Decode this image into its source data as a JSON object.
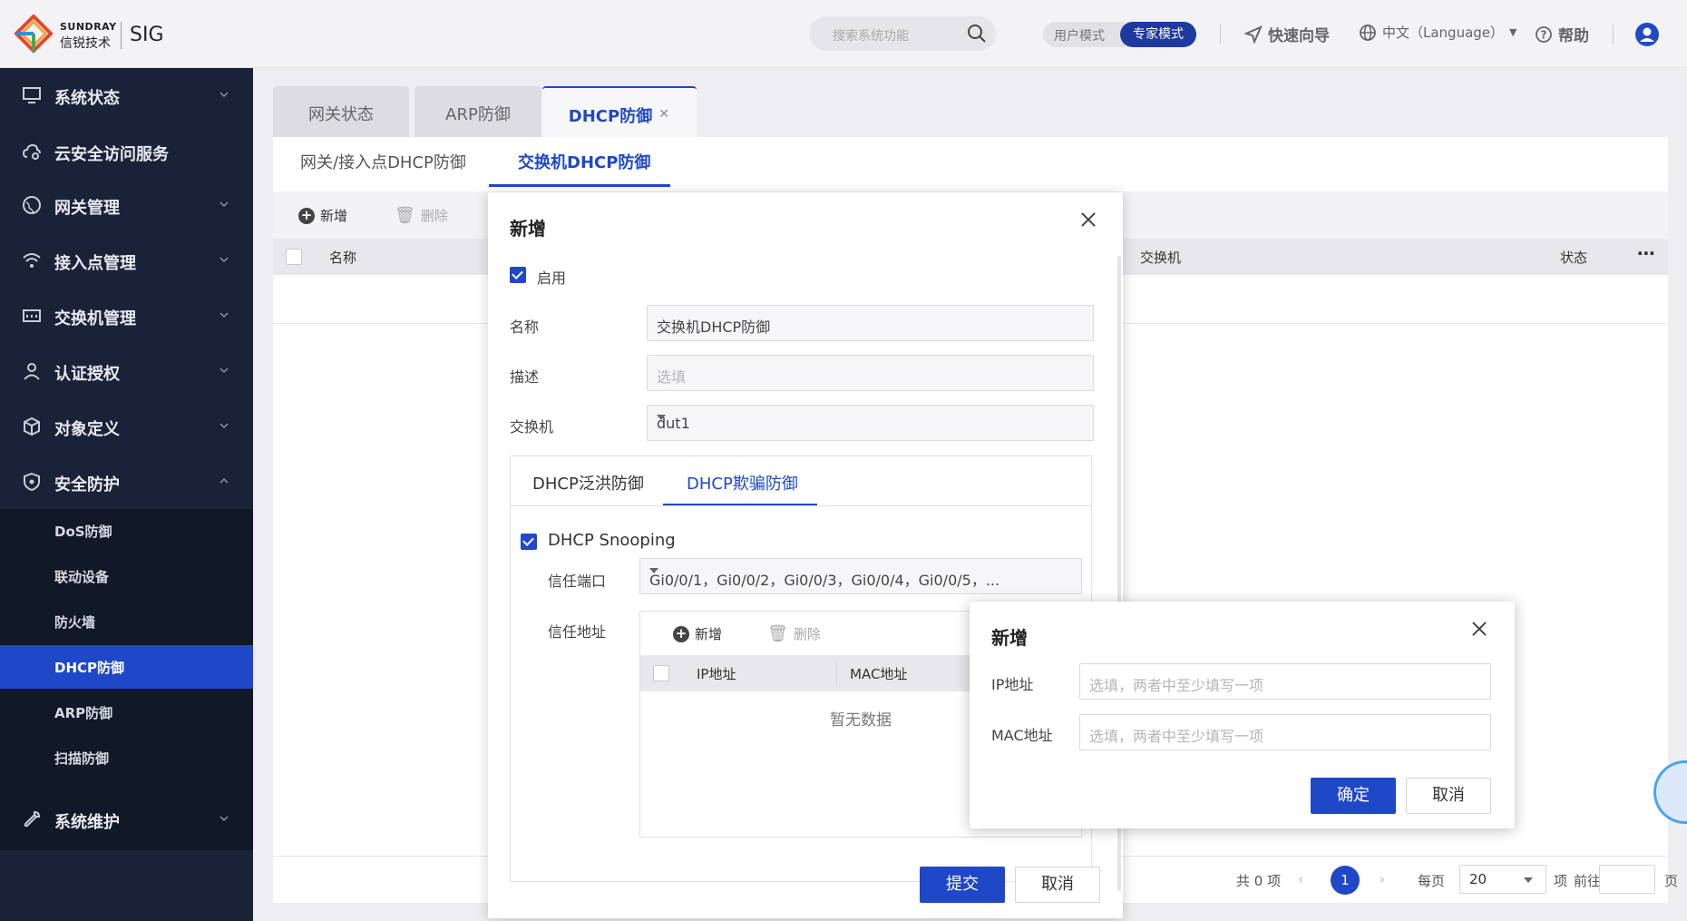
{
  "brand": {
    "en": "SUNDRAY",
    "cn": "信锐技术",
    "product": "SIG"
  },
  "topbar": {
    "search_placeholder": "搜索系统功能",
    "mode_user": "用户模式",
    "mode_expert": "专家模式",
    "quick_guide": "快速向导",
    "language": "中文（Language）",
    "help": "帮助"
  },
  "sidebar": {
    "items": [
      {
        "label": "系统状态",
        "icon": "monitor-icon"
      },
      {
        "label": "云安全访问服务",
        "icon": "cloud-icon"
      },
      {
        "label": "网关管理",
        "icon": "globe-icon"
      },
      {
        "label": "接入点管理",
        "icon": "wifi-icon"
      },
      {
        "label": "交换机管理",
        "icon": "switch-icon"
      },
      {
        "label": "认证授权",
        "icon": "user-icon"
      },
      {
        "label": "对象定义",
        "icon": "cube-icon"
      },
      {
        "label": "安全防护",
        "icon": "shield-icon"
      }
    ],
    "sub_items": [
      "DoS防御",
      "联动设备",
      "防火墙",
      "DHCP防御",
      "ARP防御",
      "扫描防御"
    ],
    "active_sub": "DHCP防御",
    "last_item": {
      "label": "系统维护",
      "icon": "wrench-icon"
    }
  },
  "page_tabs": [
    "网关状态",
    "ARP防御",
    "DHCP防御"
  ],
  "sub_tabs": [
    "网关/接入点DHCP防御",
    "交换机DHCP防御"
  ],
  "toolbar": {
    "add": "新增",
    "delete": "删除"
  },
  "table": {
    "columns": [
      "名称",
      "交换机",
      "状态"
    ]
  },
  "pagination": {
    "total": "共 0 项",
    "page": "1",
    "per_page_label": "每页",
    "per_page": "20",
    "unit": "项",
    "goto": "前往",
    "page_unit": "页"
  },
  "dialog": {
    "title": "新增",
    "enable_label": "启用",
    "name_label": "名称",
    "name_value": "交换机DHCP防御",
    "desc_label": "描述",
    "desc_placeholder": "选填",
    "switch_label": "交换机",
    "switch_value": "dut1",
    "tabs": [
      "DHCP泛洪防御",
      "DHCP欺骗防御"
    ],
    "snooping_label": "DHCP Snooping",
    "trusted_port_label": "信任端口",
    "trusted_port_value": "Gi0/0/1，Gi0/0/2，Gi0/0/3，Gi0/0/4，Gi0/0/5，...",
    "trusted_addr_label": "信任地址",
    "inner_add": "新增",
    "inner_delete": "删除",
    "inner_columns": [
      "IP地址",
      "MAC地址"
    ],
    "empty_text": "暂无数据",
    "submit": "提交",
    "cancel": "取消"
  },
  "subdialog": {
    "title": "新增",
    "ip_label": "IP地址",
    "ip_placeholder": "选填，两者中至少填写一项",
    "mac_label": "MAC地址",
    "mac_placeholder": "选填，两者中至少填写一项",
    "ok": "确定",
    "cancel": "取消"
  },
  "colors": {
    "brand_blue": "#1f48c8",
    "sidebar_bg": "#1a2238",
    "sidebar_sub_bg": "#111827"
  }
}
